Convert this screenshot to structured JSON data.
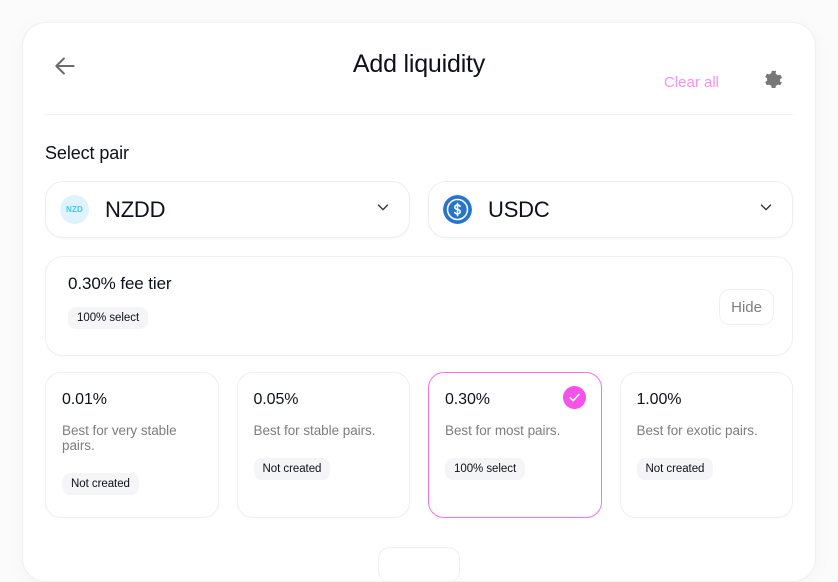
{
  "header": {
    "title": "Add liquidity",
    "back_icon": "arrow-left-icon",
    "clear_all_label": "Clear all",
    "settings_icon": "gear-icon",
    "clear_all_color": "#fb8ff5"
  },
  "select_pair": {
    "label": "Select pair",
    "tokens": [
      {
        "symbol": "NZDD",
        "icon_label": "NZD",
        "icon_kind": "nzd-token-icon",
        "icon_bg": "#dff3fd",
        "icon_fg": "#3fc5f5"
      },
      {
        "symbol": "USDC",
        "icon_label": "",
        "icon_kind": "usdc-token-icon",
        "icon_bg": "#2775ca",
        "icon_fg": "#ffffff"
      }
    ],
    "chevron_icon": "chevron-down-icon"
  },
  "fee_panel": {
    "title": "0.30% fee tier",
    "badge": "100% select",
    "toggle_label": "Hide"
  },
  "fee_tiers": {
    "selected_index": 2,
    "selected_color": "#f452e8",
    "check_icon": "check-icon",
    "items": [
      {
        "percent": "0.01%",
        "description": "Best for very stable pairs.",
        "badge": "Not created",
        "selected": false
      },
      {
        "percent": "0.05%",
        "description": "Best for stable pairs.",
        "badge": "Not created",
        "selected": false
      },
      {
        "percent": "0.30%",
        "description": "Best for most pairs.",
        "badge": "100% select",
        "selected": true
      },
      {
        "percent": "1.00%",
        "description": "Best for exotic pairs.",
        "badge": "Not created",
        "selected": false
      }
    ]
  }
}
